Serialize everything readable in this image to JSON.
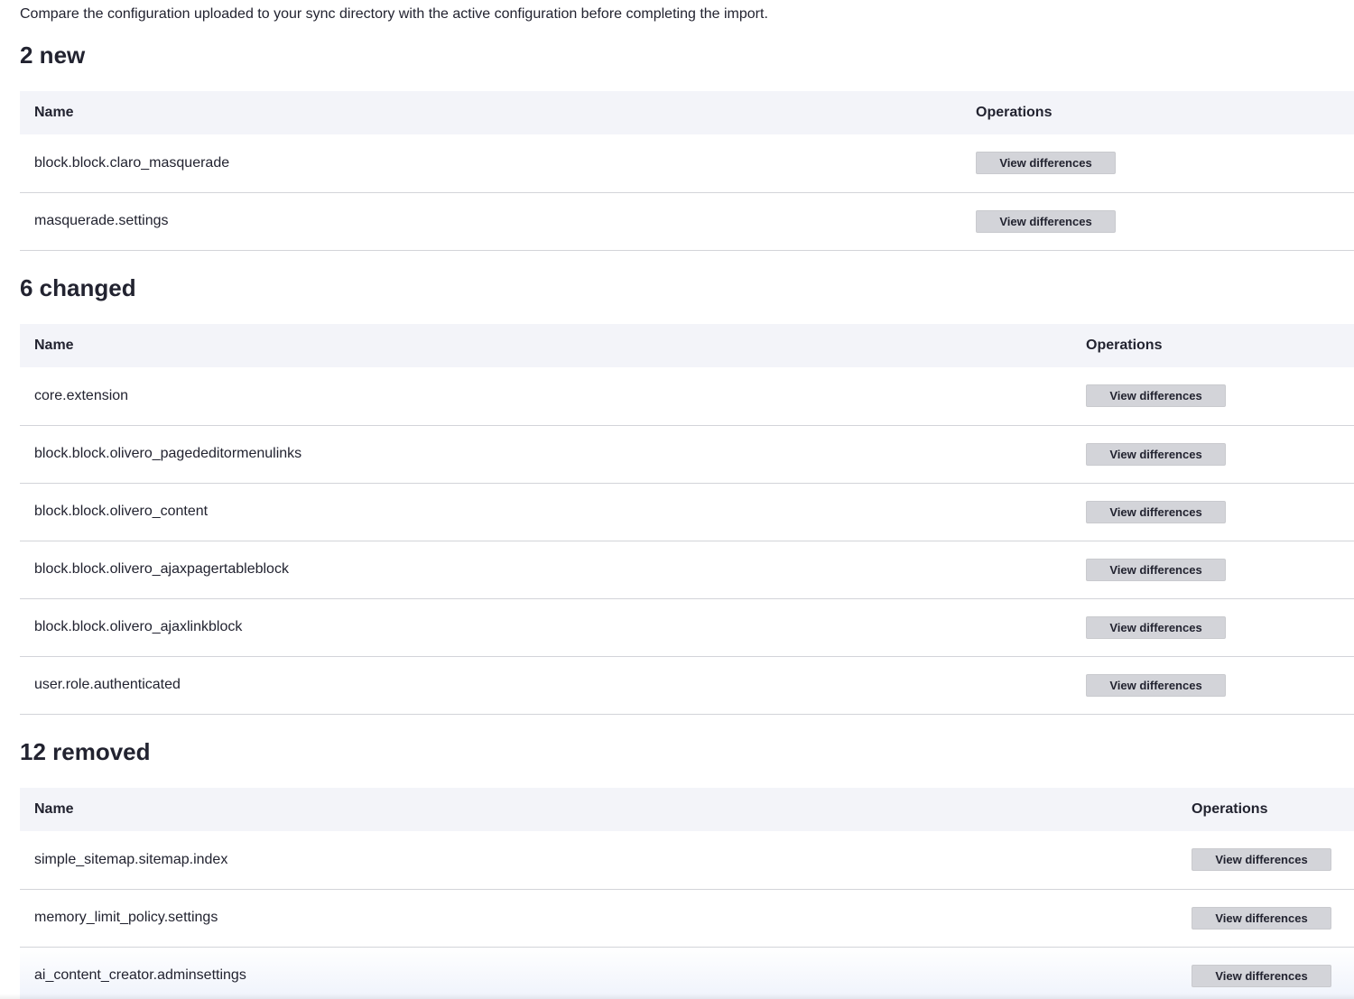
{
  "intro": "Compare the configuration uploaded to your sync directory with the active configuration before completing the import.",
  "sections": [
    {
      "heading": "2 new",
      "columns": {
        "name": "Name",
        "operations": "Operations"
      },
      "rows": [
        {
          "name": "block.block.claro_masquerade",
          "action": "View differences"
        },
        {
          "name": "masquerade.settings",
          "action": "View differences"
        }
      ]
    },
    {
      "heading": "6 changed",
      "columns": {
        "name": "Name",
        "operations": "Operations"
      },
      "rows": [
        {
          "name": "core.extension",
          "action": "View differences"
        },
        {
          "name": "block.block.olivero_pagededitormenulinks",
          "action": "View differences"
        },
        {
          "name": "block.block.olivero_content",
          "action": "View differences"
        },
        {
          "name": "block.block.olivero_ajaxpagertableblock",
          "action": "View differences"
        },
        {
          "name": "block.block.olivero_ajaxlinkblock",
          "action": "View differences"
        },
        {
          "name": "user.role.authenticated",
          "action": "View differences"
        }
      ]
    },
    {
      "heading": "12 removed",
      "columns": {
        "name": "Name",
        "operations": "Operations"
      },
      "rows": [
        {
          "name": "simple_sitemap.sitemap.index",
          "action": "View differences"
        },
        {
          "name": "memory_limit_policy.settings",
          "action": "View differences"
        },
        {
          "name": "ai_content_creator.adminsettings",
          "action": "View differences"
        }
      ]
    }
  ]
}
